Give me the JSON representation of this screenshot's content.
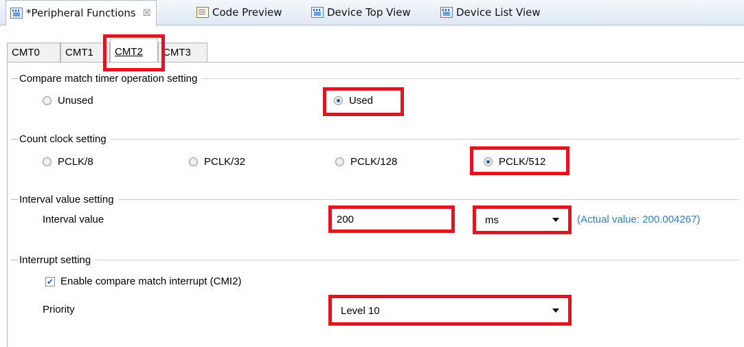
{
  "editor_tabs": [
    {
      "label": "*Peripheral Functions",
      "icon": "chip-icon",
      "close": "☒"
    },
    {
      "label": "Code Preview",
      "icon": "code-preview-icon"
    },
    {
      "label": "Device Top View",
      "icon": "chip-icon"
    },
    {
      "label": "Device List View",
      "icon": "chip-icon"
    }
  ],
  "cmt_tabs": [
    "CMT0",
    "CMT1",
    "CMT2",
    "CMT3"
  ],
  "selected_cmt_tab": "CMT2",
  "operation": {
    "heading": "Compare match timer operation setting",
    "options": [
      "Unused",
      "Used"
    ],
    "selected": "Used"
  },
  "count_clock": {
    "heading": "Count clock setting",
    "options": [
      "PCLK/8",
      "PCLK/32",
      "PCLK/128",
      "PCLK/512"
    ],
    "selected": "PCLK/512"
  },
  "interval": {
    "heading": "Interval value setting",
    "label": "Interval value",
    "value": "200",
    "unit": "ms",
    "actual": "(Actual value: 200.004267)"
  },
  "interrupt": {
    "heading": "Interrupt setting",
    "enable_label": "Enable compare match interrupt (CMI2)",
    "enable_checked": true,
    "priority_label": "Priority",
    "priority_value": "Level 10"
  },
  "highlight_color": "#e3141f",
  "accent_color": "#2f7dc6"
}
